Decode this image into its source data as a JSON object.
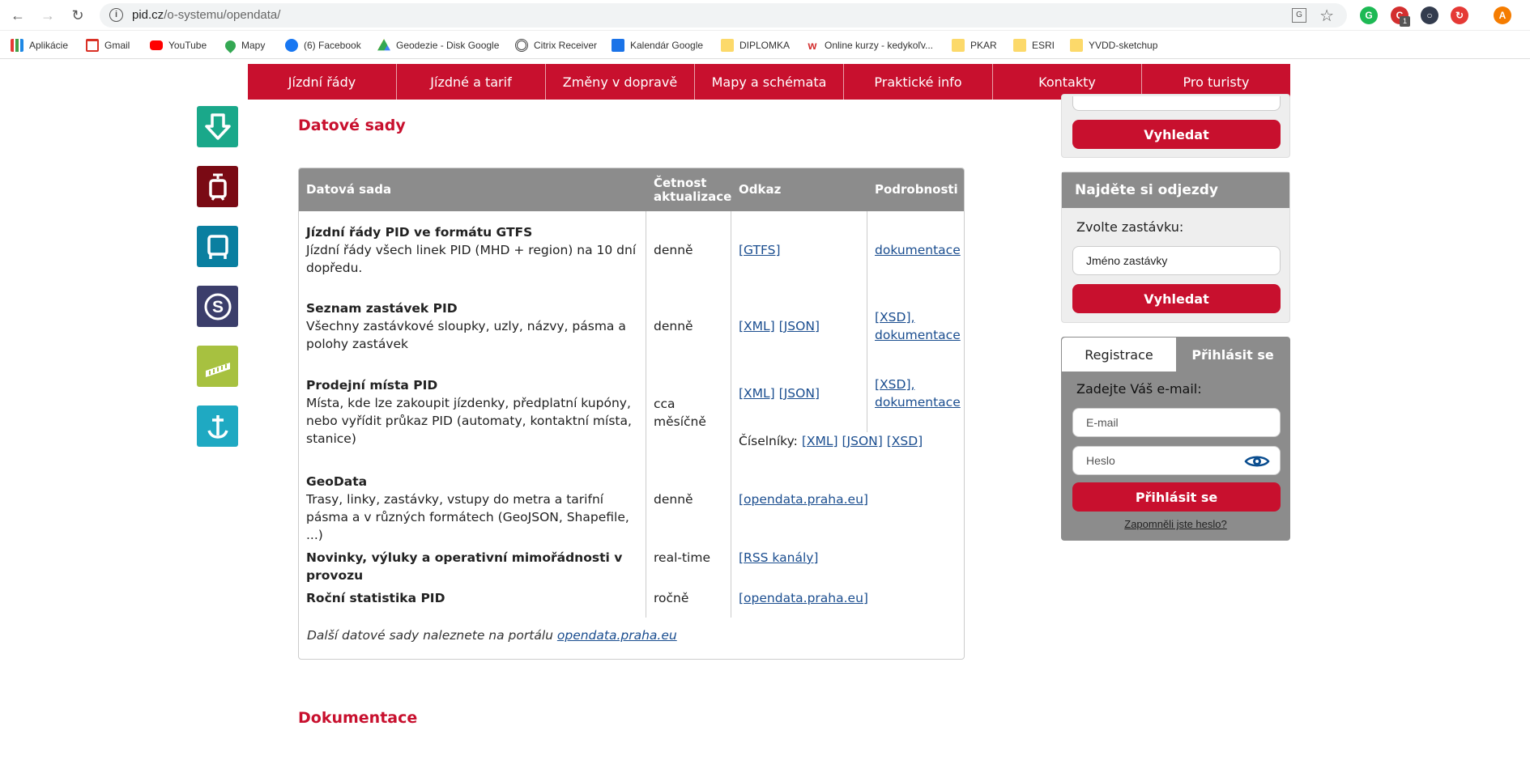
{
  "browser": {
    "url_host": "pid.cz",
    "url_path": "/o-systemu/opendata/",
    "bookmarks": [
      "Aplikácie",
      "Gmail",
      "YouTube",
      "Mapy",
      "(6) Facebook",
      "Geodezie - Disk Google",
      "Citrix Receiver",
      "Kalendár Google",
      "DIPLOMKA",
      "Online kurzy - kedykoľv...",
      "PKAR",
      "ESRI",
      "YVDD-sketchup"
    ],
    "ext_badge": "1",
    "profile_initial": "A"
  },
  "nav": [
    "Jízdní řády",
    "Jízdné a tarif",
    "Změny v dopravě",
    "Mapy a schémata",
    "Praktické info",
    "Kontakty",
    "Pro turisty"
  ],
  "main": {
    "section_title": "Datové sady",
    "doc_title": "Dokumentace",
    "table": {
      "headers": [
        "Datová sada",
        "Četnost aktualizace",
        "Odkaz",
        "Podrobnosti"
      ],
      "rows": [
        {
          "title": "Jízdní řády PID ve formátu GTFS",
          "desc": "Jízdní řády všech linek PID (MHD + region) na 10 dní dopředu.",
          "freq": "denně",
          "links": [
            "[GTFS]"
          ],
          "details": [
            "dokumentace"
          ]
        },
        {
          "title": "Seznam zastávek PID",
          "desc": "Všechny zastávkové sloupky, uzly, názvy, pásma a polohy zastávek",
          "freq": "denně",
          "links": [
            "[XML]",
            "[JSON]"
          ],
          "details": [
            "[XSD],",
            "dokumentace"
          ]
        },
        {
          "title": "Prodejní místa PID",
          "desc": "Místa, kde lze zakoupit jízdenky, předplatní kupóny, nebo vyřídit průkaz PID (automaty, kontaktní místa, stanice)",
          "freq": "cca měsíčně",
          "links": [
            "[XML]",
            "[JSON]"
          ],
          "details": [
            "[XSD],",
            "dokumentace"
          ],
          "codebook_label": "Číselníky:",
          "codebook_links": [
            "[XML]",
            "[JSON]",
            "[XSD]"
          ]
        },
        {
          "title": "GeoData",
          "desc": "Trasy, linky, zastávky, vstupy do metra a tarifní pásma a v různých formátech (GeoJSON, Shapefile, ...)",
          "freq": "denně",
          "links": [
            "[opendata.praha.eu]"
          ]
        },
        {
          "title": "Novinky, výluky a operativní mimořádnosti v provozu",
          "freq": "real-time",
          "links": [
            "[RSS kanály]"
          ]
        },
        {
          "title": "Roční statistika PID",
          "freq": "ročně",
          "links": [
            "[opendata.praha.eu]"
          ]
        }
      ],
      "footnote_text": "Další datové sady naleznete na portálu ",
      "footnote_link": "opendata.praha.eu"
    }
  },
  "sidebar": {
    "search_btn": "Vyhledat",
    "departures": {
      "title": "Najděte si odjezdy",
      "label": "Zvolte zastávku:",
      "input_value": "Jméno zastávky",
      "button": "Vyhledat"
    },
    "login": {
      "tab_register": "Registrace",
      "tab_login": "Přihlásit se",
      "email_label": "Zadejte Váš e-mail:",
      "email_placeholder": "E-mail",
      "password_placeholder": "Heslo",
      "button": "Přihlásit se",
      "forgot": "Zapomněli jste heslo?"
    }
  },
  "colors": {
    "brand": "#c8102e",
    "metro": "#1aa88a",
    "tram": "#7a0a14",
    "bus": "#0a7fa0",
    "train": "#3b3e6b",
    "cable": "#a7c140",
    "ferry": "#1fa9c2"
  }
}
